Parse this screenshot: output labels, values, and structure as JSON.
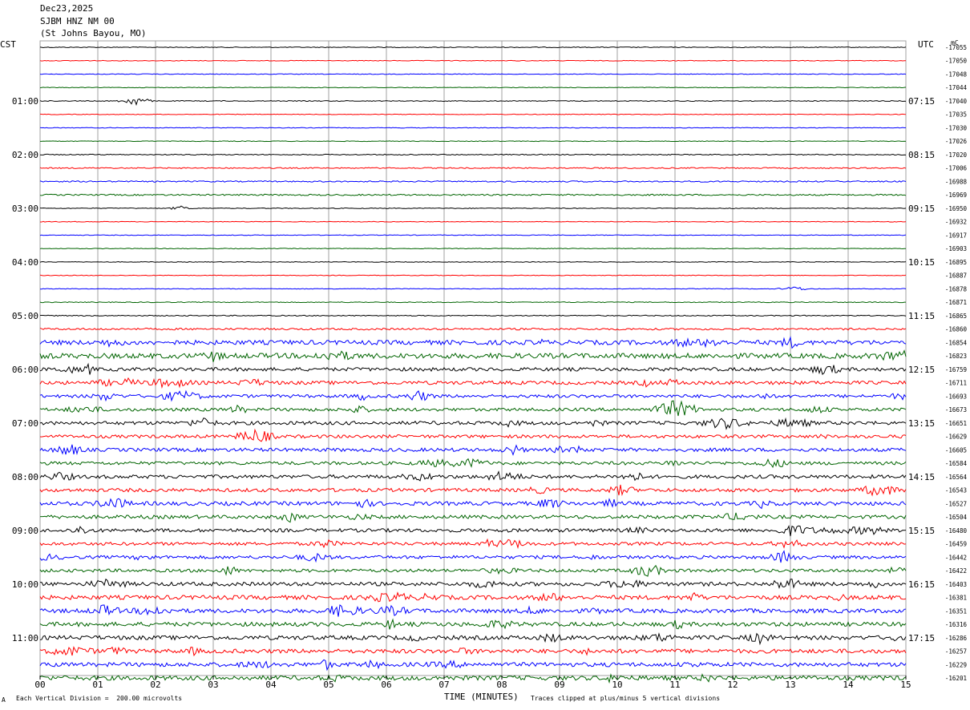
{
  "header": {
    "date": "Dec23,2025",
    "station": "SJBM HNZ NM 00",
    "location": "(St Johns Bayou, MO)"
  },
  "left_tz": "CST",
  "right_tz": "UTC",
  "right_unit": "mC",
  "footer": {
    "scale_note": "Each Vertical Division =  200.00 microvolts",
    "xlabel": "TIME (MINUTES)",
    "clip_note": "Traces clipped at plus/minus 5 vertical divisions",
    "corner_mark": "A"
  },
  "colors": {
    "trace_cycle": [
      "#000000",
      "#ff0000",
      "#0000ff",
      "#006400"
    ],
    "grid": "#a0a0a0"
  },
  "chart_data": {
    "type": "line",
    "x_ticks": [
      "00",
      "01",
      "02",
      "03",
      "04",
      "05",
      "06",
      "07",
      "08",
      "09",
      "10",
      "11",
      "12",
      "13",
      "14",
      "15"
    ],
    "xlim": [
      0,
      15
    ],
    "left_hour_labels": [
      "01:00",
      "02:00",
      "03:00",
      "04:00",
      "05:00",
      "06:00",
      "07:00",
      "08:00",
      "09:00",
      "10:00",
      "11:00"
    ],
    "right_hour_labels": [
      "07:15",
      "08:15",
      "09:15",
      "10:15",
      "11:15",
      "12:15",
      "13:15",
      "14:15",
      "15:15",
      "16:15",
      "17:15"
    ],
    "hour_label_rows": [
      4,
      8,
      12,
      16,
      20,
      24,
      28,
      32,
      36,
      40,
      44
    ],
    "trace_offsets": [
      -17055,
      -17050,
      -17048,
      -17044,
      -17040,
      -17035,
      -17030,
      -17026,
      -17020,
      -17006,
      -16988,
      -16969,
      -16950,
      -16932,
      -16917,
      -16903,
      -16895,
      -16887,
      -16878,
      -16871,
      -16865,
      -16860,
      -16854,
      -16823,
      -16759,
      -16711,
      -16693,
      -16673,
      -16651,
      -16629,
      -16605,
      -16584,
      -16564,
      -16543,
      -16527,
      -16504,
      -16480,
      -16459,
      -16442,
      -16422,
      -16403,
      -16381,
      -16351,
      -16316,
      -16286,
      -16257,
      -16229,
      -16201
    ],
    "trace_noise_level": [
      0.5,
      0.4,
      0.4,
      0.4,
      0.5,
      0.4,
      0.4,
      0.4,
      0.6,
      0.7,
      0.8,
      0.9,
      0.5,
      0.4,
      0.4,
      0.4,
      0.4,
      0.4,
      0.4,
      0.5,
      0.6,
      1.2,
      2.8,
      3.2,
      2.2,
      2.2,
      2.0,
      2.0,
      2.2,
      2.0,
      2.2,
      2.0,
      2.2,
      2.2,
      2.4,
      2.2,
      2.2,
      2.0,
      2.0,
      2.0,
      2.4,
      2.6,
      2.6,
      2.6,
      2.6,
      2.6,
      2.6,
      2.8
    ]
  }
}
